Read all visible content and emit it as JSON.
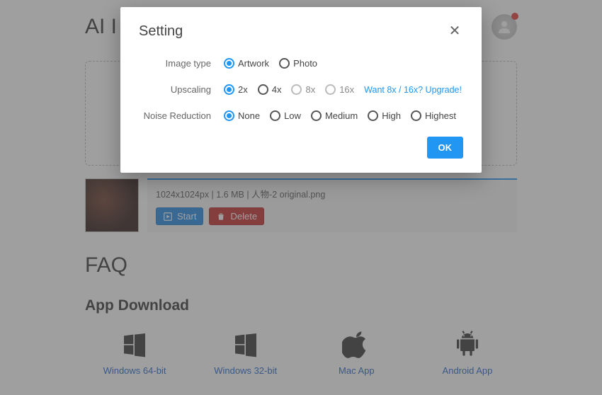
{
  "page": {
    "title_visible_fragment": "AI I",
    "faq_heading": "FAQ",
    "download_heading": "App Download"
  },
  "file": {
    "meta": "1024x1024px | 1.6 MB | 人物-2 original.png",
    "start_label": "Start",
    "delete_label": "Delete"
  },
  "downloads": {
    "items": [
      {
        "label": "Windows 64-bit",
        "icon": "windows"
      },
      {
        "label": "Windows 32-bit",
        "icon": "windows"
      },
      {
        "label": "Mac App",
        "icon": "apple"
      },
      {
        "label": "Android App",
        "icon": "android"
      }
    ]
  },
  "modal": {
    "title": "Setting",
    "ok_label": "OK",
    "rows": {
      "image_type": {
        "label": "Image type",
        "options": [
          {
            "label": "Artwork",
            "selected": true
          },
          {
            "label": "Photo",
            "selected": false
          }
        ]
      },
      "upscaling": {
        "label": "Upscaling",
        "options": [
          {
            "label": "2x",
            "selected": true
          },
          {
            "label": "4x",
            "selected": false
          },
          {
            "label": "8x",
            "selected": false,
            "disabled": true
          },
          {
            "label": "16x",
            "selected": false,
            "disabled": true
          }
        ],
        "upgrade_text": "Want 8x / 16x? Upgrade!"
      },
      "noise": {
        "label": "Noise Reduction",
        "options": [
          {
            "label": "None",
            "selected": true
          },
          {
            "label": "Low",
            "selected": false
          },
          {
            "label": "Medium",
            "selected": false
          },
          {
            "label": "High",
            "selected": false
          },
          {
            "label": "Highest",
            "selected": false
          }
        ]
      }
    }
  }
}
